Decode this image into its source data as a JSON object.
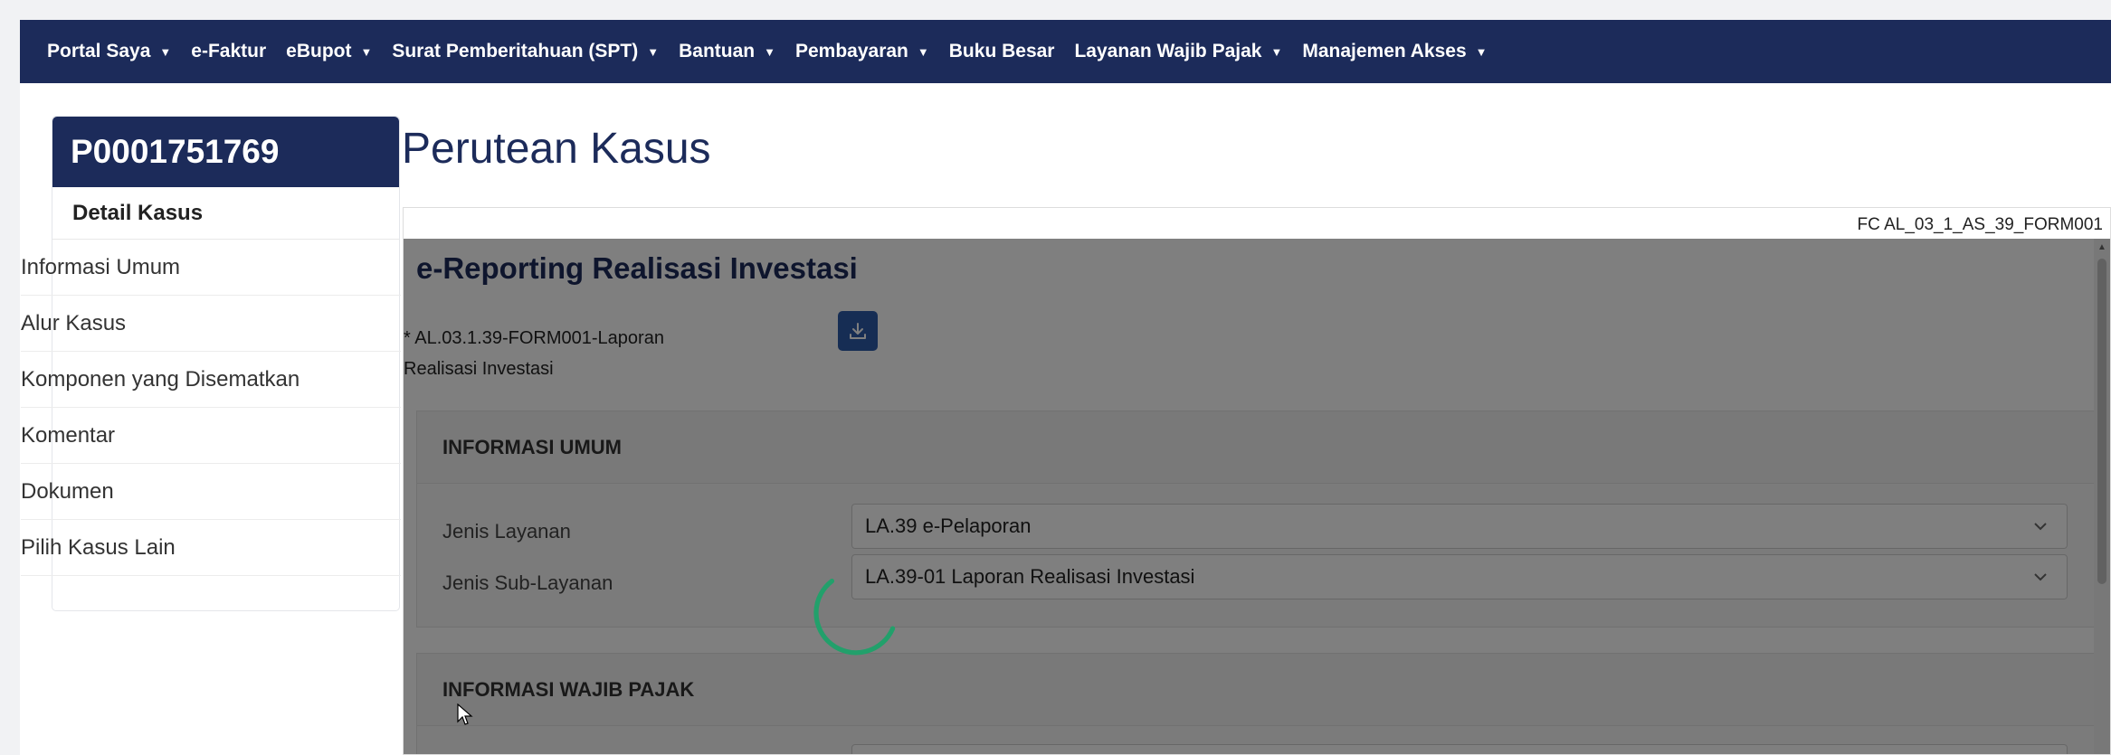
{
  "nav": {
    "items": [
      {
        "label": "Portal Saya",
        "dropdown": true
      },
      {
        "label": "e-Faktur",
        "dropdown": false
      },
      {
        "label": "eBupot",
        "dropdown": true
      },
      {
        "label": "Surat Pemberitahuan (SPT)",
        "dropdown": true
      },
      {
        "label": "Bantuan",
        "dropdown": true
      },
      {
        "label": "Pembayaran",
        "dropdown": true
      },
      {
        "label": "Buku Besar",
        "dropdown": false
      },
      {
        "label": "Layanan Wajib Pajak",
        "dropdown": true
      },
      {
        "label": "Manajemen Akses",
        "dropdown": true
      }
    ]
  },
  "sidebar": {
    "case_id": "P0001751769",
    "heading": "Detail Kasus",
    "items": [
      {
        "label": "Informasi Umum"
      },
      {
        "label": "Alur Kasus"
      },
      {
        "label": "Komponen yang Disematkan"
      },
      {
        "label": "Komentar"
      },
      {
        "label": "Dokumen"
      },
      {
        "label": "Pilih Kasus Lain"
      }
    ]
  },
  "page": {
    "title": "Perutean Kasus",
    "form_code": "FC AL_03_1_AS_39_FORM001"
  },
  "form": {
    "title": "e-Reporting Realisasi Investasi",
    "file_label_1": "* AL.03.1.39-FORM001-Laporan",
    "file_label_2": "Realisasi Investasi",
    "sections": {
      "umum": {
        "heading": "INFORMASI UMUM",
        "fields": [
          {
            "label": "Jenis Layanan",
            "value": "LA.39 e-Pelaporan"
          },
          {
            "label": "Jenis Sub-Layanan",
            "value": "LA.39-01 Laporan Realisasi Investasi"
          }
        ]
      },
      "wajib_pajak": {
        "heading": "INFORMASI WAJIB PAJAK"
      }
    }
  },
  "colors": {
    "brand_navy": "#1c2b5a",
    "spinner": "#22a06b",
    "download_button": "#2d5aa8"
  }
}
